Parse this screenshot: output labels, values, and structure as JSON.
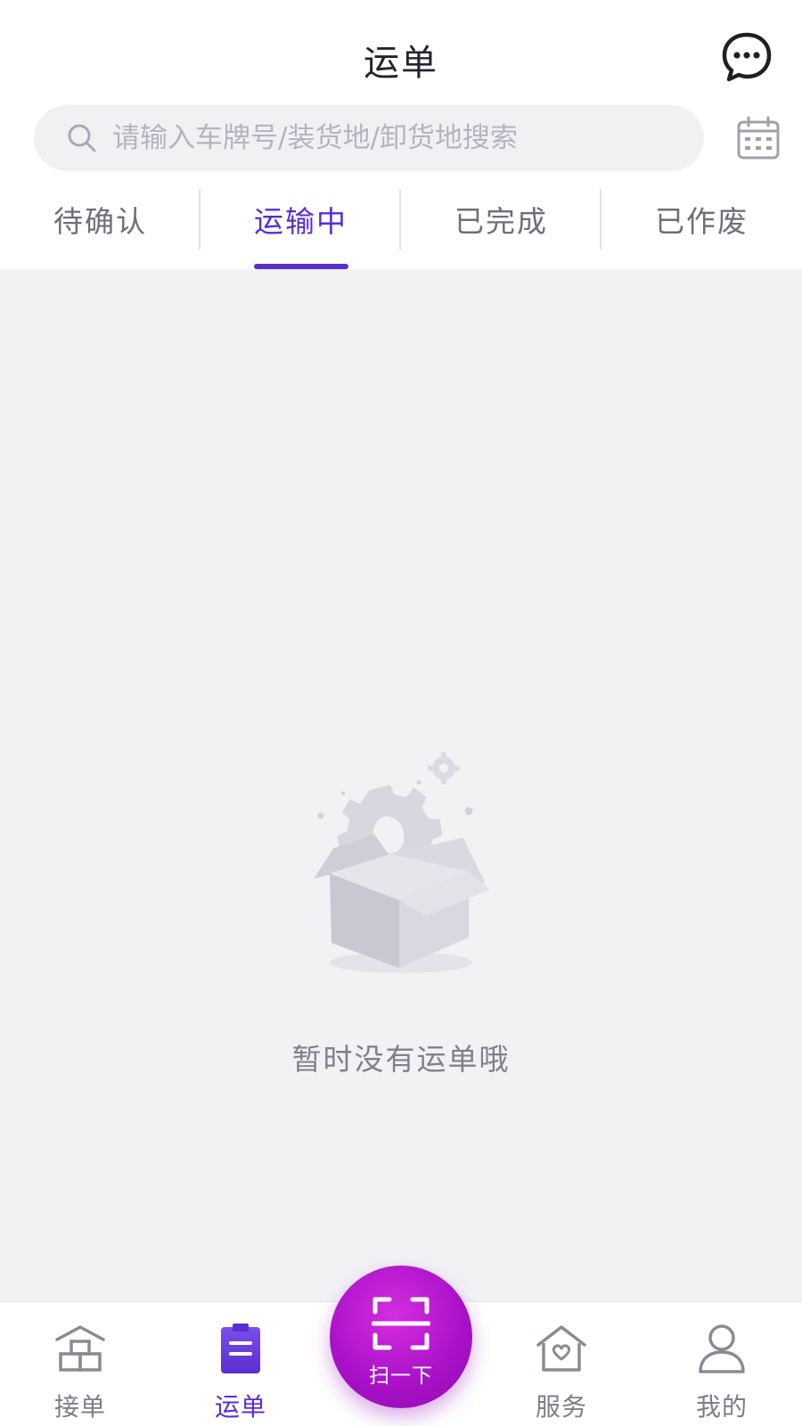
{
  "header": {
    "title": "运单",
    "message_icon": "chat-bubble-icon",
    "calendar_icon": "calendar-icon"
  },
  "search": {
    "placeholder": "请输入车牌号/装货地/卸货地搜索",
    "value": ""
  },
  "tabs": [
    {
      "label": "待确认",
      "active": false
    },
    {
      "label": "运输中",
      "active": true
    },
    {
      "label": "已完成",
      "active": false
    },
    {
      "label": "已作废",
      "active": false
    }
  ],
  "empty_state": {
    "text": "暂时没有运单哦",
    "illustration": "empty-box-gears-icon"
  },
  "tabbar": {
    "items": [
      {
        "label": "接单",
        "icon": "order-house-icon",
        "active": false
      },
      {
        "label": "运单",
        "icon": "clipboard-icon",
        "active": true
      },
      {
        "label": "服务",
        "icon": "heart-house-icon",
        "active": false
      },
      {
        "label": "我的",
        "icon": "user-icon",
        "active": false
      }
    ],
    "scan": {
      "label": "扫一下",
      "icon": "scan-frame-icon"
    }
  },
  "colors": {
    "accent": "#5a2ed0",
    "scan_button": "#b318cc",
    "background": "#f2f2f5",
    "text_muted": "#6e6e7a"
  }
}
